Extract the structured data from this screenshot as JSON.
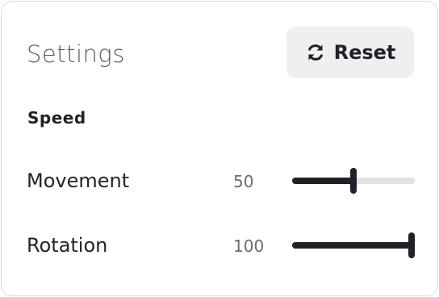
{
  "panel": {
    "title": "Settings",
    "reset": {
      "label": "Reset",
      "icon": "refresh-icon"
    }
  },
  "speed": {
    "section_title": "Speed",
    "rows": [
      {
        "label": "Movement",
        "value": "50",
        "level": 0.5
      },
      {
        "label": "Rotation",
        "value": "100",
        "level": 1.0
      }
    ]
  },
  "colors": {
    "accent": "#1f2226",
    "track": "#e2e2e2",
    "button_bg": "#eeeff0",
    "border": "#dcdcdc"
  }
}
